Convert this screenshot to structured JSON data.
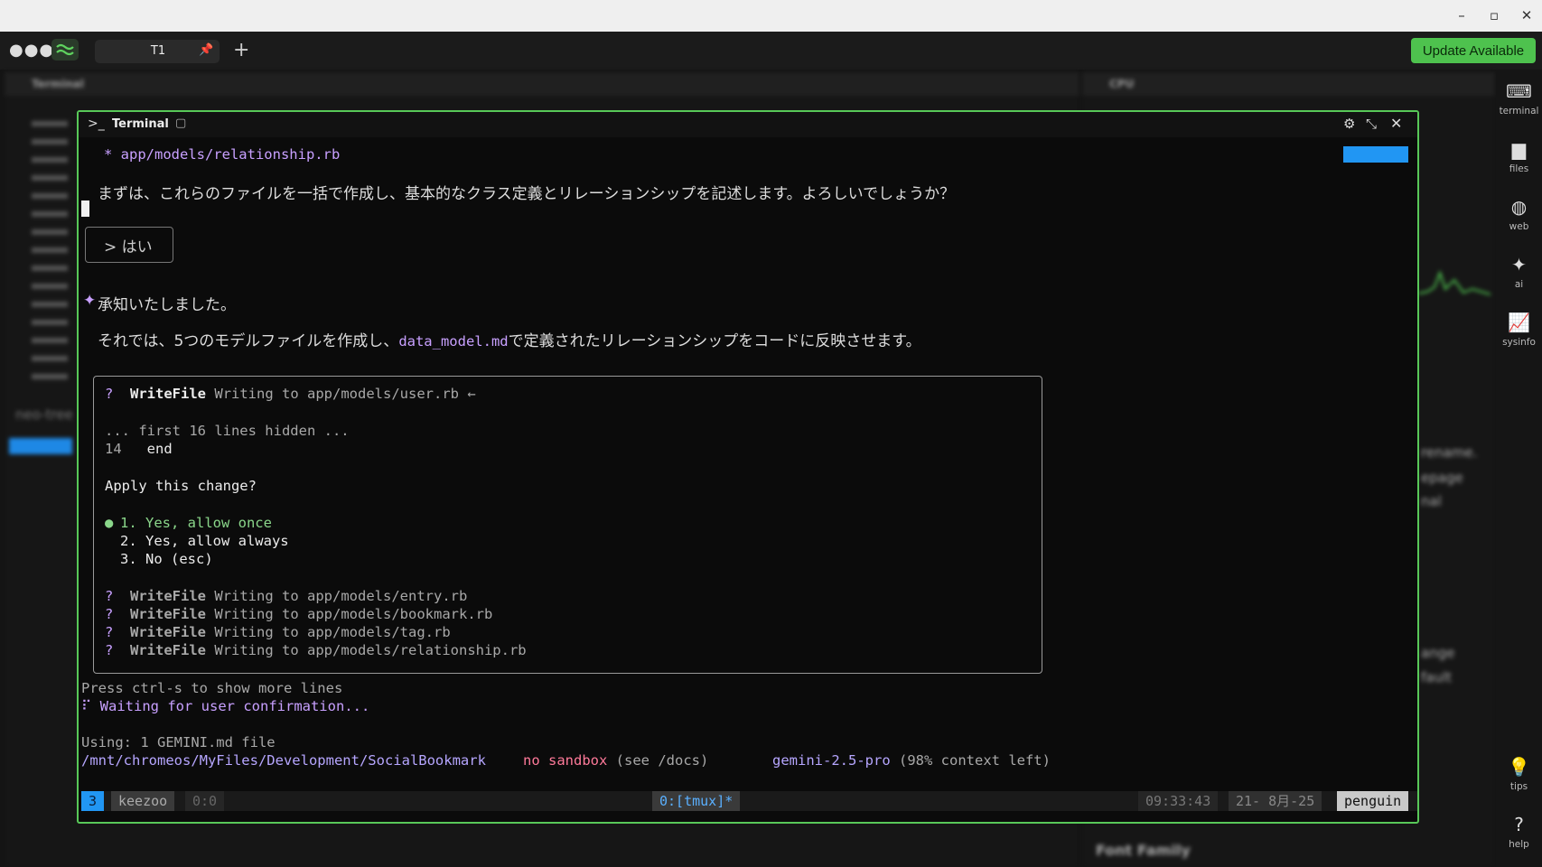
{
  "app": {
    "window_controls": [
      "–",
      "▫",
      "✕"
    ],
    "tab": {
      "label": "T1"
    },
    "update_label": "Update Available"
  },
  "colors": {
    "accent": "#58c858",
    "update": "#4ec24e",
    "status_blue": "#2196f3",
    "purple": "#c8a0ff"
  },
  "background": {
    "left_panel_title": "Terminal",
    "right_panel_title": "CPU",
    "right_snippets": [
      "rename.",
      "epage",
      "nal",
      "ange",
      "fault"
    ],
    "font_family_label": "Font Family",
    "left_bottom_text": "neo-tree"
  },
  "sidebar": {
    "items": [
      {
        "icon": "terminal-icon",
        "label": "terminal"
      },
      {
        "icon": "folder-icon",
        "label": "files"
      },
      {
        "icon": "globe-icon",
        "label": "web"
      },
      {
        "icon": "sparkles-icon",
        "label": "ai"
      },
      {
        "icon": "chart-icon",
        "label": "sysinfo"
      },
      {
        "icon": "lightbulb-icon",
        "label": "tips"
      },
      {
        "icon": "help-icon",
        "label": "help"
      }
    ]
  },
  "terminal": {
    "title": "Terminal",
    "line_bullet_file": "* app/models/relationship.rb",
    "question": "まずは、これらのファイルを一括で作成し、基本的なクラス定義とリレーションシップを記述します。よろしいでしょうか？",
    "answer": "> はい",
    "ack_symbol": "✦",
    "ack": "承知いたしました。",
    "plan_prefix": "それでは、5つのモデルファイルを作成し、",
    "plan_highlight": "data_model.md",
    "plan_suffix": "で定義されたリレーションシップをコードに反映させます。",
    "dialog": {
      "q_mark": "?",
      "tool": "WriteFile",
      "current_target": "Writing to app/models/user.rb ←",
      "hidden_note": "... first 16 lines hidden ...",
      "code_line_num": "14",
      "code_line": "end",
      "apply_question": "Apply this change?",
      "options": [
        "1. Yes, allow once",
        "2. Yes, allow always",
        "3. No (esc)"
      ],
      "pending": [
        "Writing to app/models/entry.rb",
        "Writing to app/models/bookmark.rb",
        "Writing to app/models/tag.rb",
        "Writing to app/models/relationship.rb"
      ]
    },
    "press_hint": "Press ctrl-s to show more lines",
    "waiting": "⠏ Waiting for user confirmation...",
    "using": "Using: 1 GEMINI.md file",
    "path": "/mnt/chromeos/MyFiles/Development/SocialBookmark",
    "sandbox": "no sandbox",
    "sandbox_hint": "(see /docs)",
    "model": "gemini-2.5-pro",
    "model_context": "(98% context left)"
  },
  "tmux": {
    "window_num": "3",
    "session": "keezoo",
    "pane": "0:0",
    "window": "0:[tmux]*",
    "time": "09:33:43",
    "date": "21- 8月-25",
    "host": "penguin"
  }
}
